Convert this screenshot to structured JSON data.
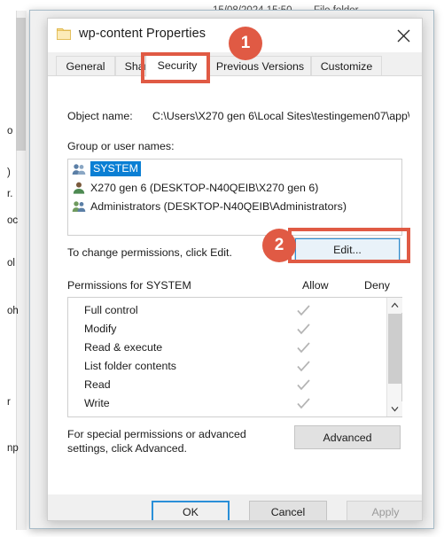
{
  "background": {
    "date_modified": "15/08/2024 15:50",
    "file_type": "File folder",
    "left_fragments": [
      "o",
      ")",
      "r.",
      "oc",
      "ol",
      "oh",
      "r",
      "np"
    ]
  },
  "dialog": {
    "title": "wp-content Properties",
    "folder_icon": "folder-icon",
    "close_icon": "close-icon",
    "tabs": [
      {
        "label": "General",
        "active": false
      },
      {
        "label": "Sharing",
        "active": false
      },
      {
        "label": "Security",
        "active": true
      },
      {
        "label": "Previous Versions",
        "active": false
      },
      {
        "label": "Customize",
        "active": false
      }
    ],
    "object_name_label": "Object name:",
    "object_name_value": "C:\\Users\\X270 gen 6\\Local Sites\\testingemen07\\app\\p",
    "group_names_label": "Group or user names:",
    "groups": [
      {
        "label": "SYSTEM",
        "icon": "group-users-icon",
        "selected": true
      },
      {
        "label": "X270 gen 6 (DESKTOP-N40QEIB\\X270 gen 6)",
        "icon": "single-user-icon",
        "selected": false
      },
      {
        "label": "Administrators (DESKTOP-N40QEIB\\Administrators)",
        "icon": "group-users-icon",
        "selected": false
      }
    ],
    "edit_hint": "To change permissions, click Edit.",
    "edit_button": "Edit...",
    "permissions_title": "Permissions for SYSTEM",
    "allow_header": "Allow",
    "deny_header": "Deny",
    "permissions": [
      {
        "name": "Full control",
        "allow": true,
        "deny": false
      },
      {
        "name": "Modify",
        "allow": true,
        "deny": false
      },
      {
        "name": "Read & execute",
        "allow": true,
        "deny": false
      },
      {
        "name": "List folder contents",
        "allow": true,
        "deny": false
      },
      {
        "name": "Read",
        "allow": true,
        "deny": false
      },
      {
        "name": "Write",
        "allow": true,
        "deny": false
      }
    ],
    "scroll_up_icon": "chevron-up-icon",
    "scroll_down_icon": "chevron-down-icon",
    "advanced_hint": "For special permissions or advanced settings, click Advanced.",
    "advanced_button": "Advanced",
    "footer": {
      "ok": "OK",
      "cancel": "Cancel",
      "apply": "Apply"
    }
  },
  "annotations": {
    "color": "#e05a44",
    "badges": [
      {
        "number": "1",
        "target": "security-tab"
      },
      {
        "number": "2",
        "target": "edit-button"
      }
    ]
  }
}
